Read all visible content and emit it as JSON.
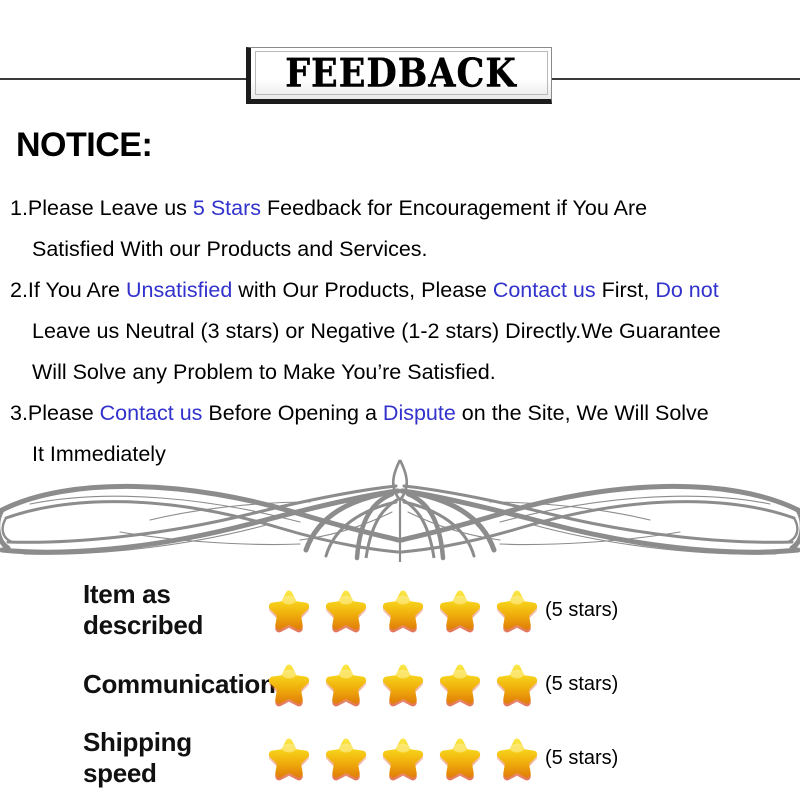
{
  "header": {
    "banner_title": "FEEDBACK"
  },
  "notice": {
    "heading": "NOTICE:",
    "lines": [
      {
        "segments": [
          {
            "text": "1.Please Leave us ",
            "color": "black"
          },
          {
            "text": " 5 Stars ",
            "color": "blue"
          },
          {
            "text": " Feedback for  Encouragement  if You Are",
            "color": "black"
          }
        ],
        "indent": false
      },
      {
        "segments": [
          {
            "text": "Satisfied With our Products and Services.",
            "color": "black"
          }
        ],
        "indent": true
      },
      {
        "segments": [
          {
            "text": "2.If You Are ",
            "color": "black"
          },
          {
            "text": "Unsatisfied",
            "color": "blue"
          },
          {
            "text": " with Our Products, Please ",
            "color": "black"
          },
          {
            "text": "Contact us",
            "color": "blue"
          },
          {
            "text": " First, ",
            "color": "black"
          },
          {
            "text": "Do not",
            "color": "blue"
          }
        ],
        "indent": false
      },
      {
        "segments": [
          {
            "text": "Leave us Neutral (3 stars) or Negative (1-2 stars) Directly.We Guarantee",
            "color": "black"
          }
        ],
        "indent": true
      },
      {
        "segments": [
          {
            "text": "Will Solve any Problem to Make You’re  Satisfied.",
            "color": "black"
          }
        ],
        "indent": true
      },
      {
        "segments": [
          {
            "text": "3.Please ",
            "color": "black"
          },
          {
            "text": "Contact us",
            "color": "blue"
          },
          {
            "text": " Before Opening a ",
            "color": "black"
          },
          {
            "text": "Dispute",
            "color": "blue"
          },
          {
            "text": " on the Site, We Will Solve",
            "color": "black"
          }
        ],
        "indent": false
      },
      {
        "segments": [
          {
            "text": "It Immediately",
            "color": "black"
          }
        ],
        "indent": true
      }
    ]
  },
  "ornament": {
    "name": "decorative-flourish-divider",
    "color": "#8c8c8c"
  },
  "ratings": {
    "rows": [
      {
        "label": "Item as described",
        "stars": 5,
        "count_label": "(5 stars)"
      },
      {
        "label": "Communication",
        "stars": 5,
        "count_label": "(5 stars)"
      },
      {
        "label": "Shipping speed",
        "stars": 5,
        "count_label": "(5 stars)"
      }
    ]
  },
  "colors": {
    "link_blue": "#3232cc",
    "star_top": "#f7e03a",
    "star_mid": "#f2c00c",
    "star_bottom": "#e8860d",
    "star_shadow": "#d9502a",
    "ornament_gray": "#8c8c8c",
    "rule_dark": "#3a3a3a"
  }
}
